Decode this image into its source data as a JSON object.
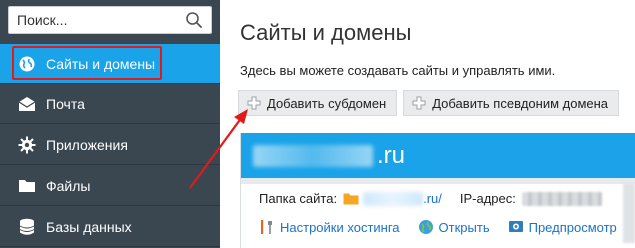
{
  "sidebar": {
    "search": {
      "placeholder": "Поиск..."
    },
    "items": [
      {
        "label": "Сайты и домены",
        "icon": "globe-icon",
        "active": true
      },
      {
        "label": "Почта",
        "icon": "envelope-icon"
      },
      {
        "label": "Приложения",
        "icon": "gear-icon"
      },
      {
        "label": "Файлы",
        "icon": "folder-icon"
      },
      {
        "label": "Базы данных",
        "icon": "database-icon"
      }
    ]
  },
  "main": {
    "title": "Сайты и домены",
    "description": "Здесь вы можете создавать сайты и управлять ими.",
    "toolbar": {
      "add_subdomain": "Добавить субдомен",
      "add_alias": "Добавить псевдоним домена"
    },
    "domain": {
      "tld": ".ru",
      "folder_label": "Папка сайта:",
      "folder_suffix": ".ru/",
      "ip_label": "IP-адрес:",
      "actions": {
        "hosting_settings": "Настройки хостинга",
        "open": "Открыть",
        "preview": "Предпросмотр"
      }
    }
  },
  "colors": {
    "sidebar_bg": "#3a4751",
    "accent": "#1aa3e8",
    "highlight": "#e01b1b",
    "link": "#1a73c9"
  }
}
